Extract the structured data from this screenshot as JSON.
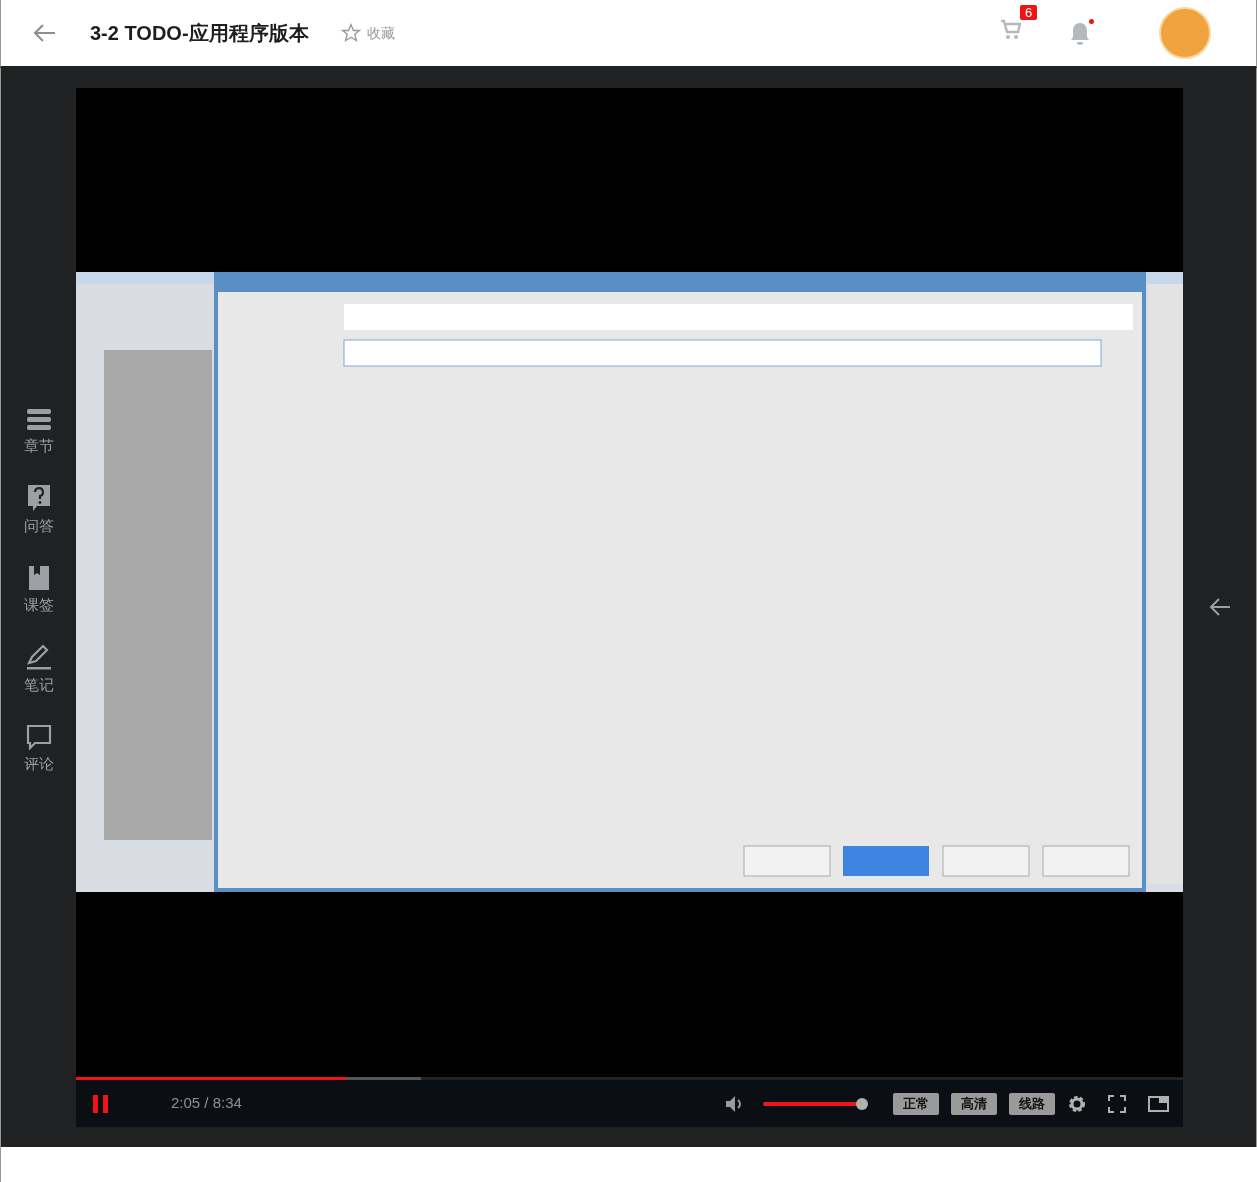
{
  "header": {
    "title": "3-2 TODO-应用程序版本",
    "favorite": {
      "label": "收藏",
      "selected": false
    },
    "cart_count": "6",
    "notifications_unread": true
  },
  "sidebar": {
    "items": [
      {
        "kind": "chapters",
        "label": "章节"
      },
      {
        "kind": "questions",
        "label": "问答"
      },
      {
        "kind": "bookmarks",
        "label": "课签"
      },
      {
        "kind": "notes",
        "label": "笔记"
      },
      {
        "kind": "comments",
        "label": "评论"
      }
    ]
  },
  "player": {
    "playing": true,
    "progress": {
      "level": 0.244
    },
    "buffered": {
      "level": 0.312
    },
    "time": "2:05 / 8:34",
    "volume": {
      "level": 0.9
    },
    "buttons": [
      {
        "label": "正常"
      },
      {
        "label": "高清"
      },
      {
        "label": "线路"
      }
    ]
  }
}
